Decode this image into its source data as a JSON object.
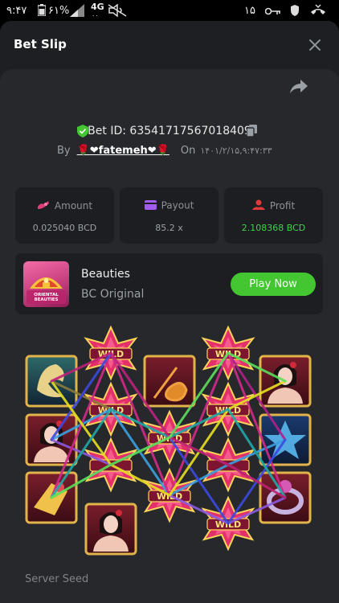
{
  "status_bar": {
    "time": "۹:۴۷",
    "battery": "۶۱%",
    "network": "4G",
    "net_sub": "۰۰",
    "right_number": "۱۵"
  },
  "sheet": {
    "title": "Bet Slip",
    "close_icon": "close-icon"
  },
  "bet": {
    "bet_id_label": "Bet ID: 63541717567018409",
    "by_label": "By",
    "username": "🌹❤fatemeh❤🌹",
    "on_label": "On",
    "date": "۱۴۰۱/۲/۱۵,۹:۴۷:۳۳"
  },
  "stats": [
    {
      "label": "Amount",
      "value": "0.025040 BCD",
      "icon": "coins-icon",
      "color": "#e0407a"
    },
    {
      "label": "Payout",
      "value": "85.2 x",
      "icon": "wallet-icon",
      "color": "#a35cf0"
    },
    {
      "label": "Profit",
      "value": "2.108368 BCD",
      "icon": "profit-icon",
      "color": "#e03a3a",
      "value_color": "#43d24b"
    }
  ],
  "game": {
    "name": "Beauties",
    "provider": "BC Original",
    "play_label": "Play Now",
    "thumb_text": "ORIENTAL BEAUTIES"
  },
  "reels": {
    "wild_text": "WILD"
  },
  "server_seed_label": "Server Seed",
  "colors": {
    "accent_green": "#43c632",
    "sheet_bg": "#1d1f22",
    "card_bg": "#26282c"
  }
}
